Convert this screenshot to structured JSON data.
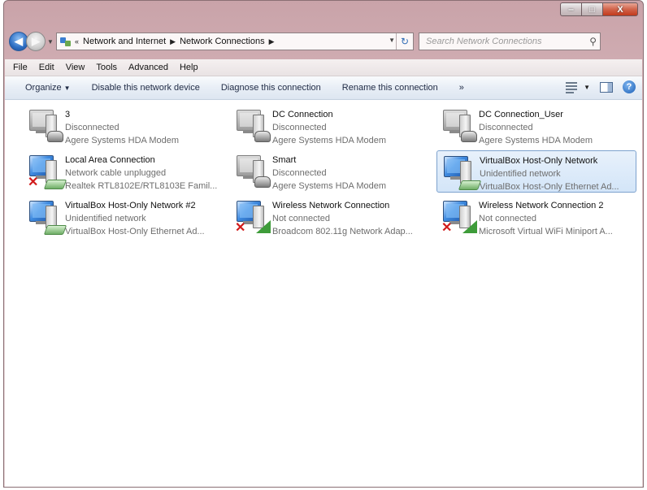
{
  "window": {
    "minimize_glyph": "‒",
    "maximize_glyph": "□",
    "close_glyph": "X"
  },
  "address": {
    "breadcrumbs": [
      "Network and Internet",
      "Network Connections"
    ],
    "prefix": "«"
  },
  "search": {
    "placeholder": "Search Network Connections"
  },
  "menu": [
    "File",
    "Edit",
    "View",
    "Tools",
    "Advanced",
    "Help"
  ],
  "toolbar": {
    "organize": "Organize",
    "disable": "Disable this network device",
    "diagnose": "Diagnose this connection",
    "rename": "Rename this connection",
    "more": "»"
  },
  "connections": [
    {
      "name": "3",
      "status": "Disconnected",
      "device": "Agere Systems HDA Modem",
      "icon": "modem-computer-icon",
      "error": false,
      "selected": false
    },
    {
      "name": "DC Connection",
      "status": "Disconnected",
      "device": "Agere Systems HDA Modem",
      "icon": "modem-computer-icon",
      "error": false,
      "selected": false
    },
    {
      "name": "DC Connection_User",
      "status": "Disconnected",
      "device": "Agere Systems HDA Modem",
      "icon": "modem-computer-icon",
      "error": false,
      "selected": false
    },
    {
      "name": "Local Area Connection",
      "status": "Network cable unplugged",
      "device": "Realtek RTL8102E/RTL8103E Famil...",
      "icon": "ethernet-computer-icon",
      "error": true,
      "selected": false
    },
    {
      "name": "Smart",
      "status": "Disconnected",
      "device": "Agere Systems HDA Modem",
      "icon": "modem-computer-icon",
      "error": false,
      "selected": false
    },
    {
      "name": "VirtualBox Host-Only Network",
      "status": "Unidentified network",
      "device": "VirtualBox Host-Only Ethernet Ad...",
      "icon": "ethernet-computer-icon",
      "error": false,
      "selected": true
    },
    {
      "name": "VirtualBox Host-Only Network #2",
      "status": "Unidentified network",
      "device": "VirtualBox Host-Only Ethernet Ad...",
      "icon": "ethernet-computer-icon",
      "error": false,
      "selected": false
    },
    {
      "name": "Wireless Network Connection",
      "status": "Not connected",
      "device": "Broadcom 802.11g Network Adap...",
      "icon": "wireless-computer-icon",
      "error": true,
      "selected": false
    },
    {
      "name": "Wireless Network Connection 2",
      "status": "Not connected",
      "device": "Microsoft Virtual WiFi Miniport A...",
      "icon": "wireless-computer-icon",
      "error": true,
      "selected": false
    }
  ]
}
